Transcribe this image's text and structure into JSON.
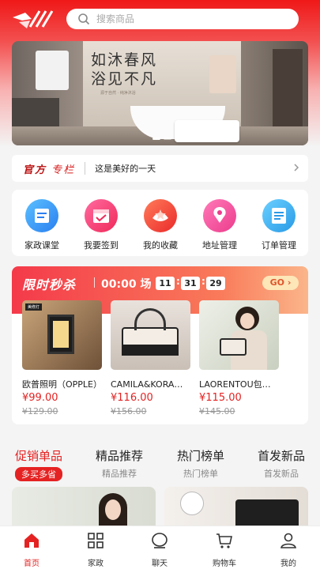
{
  "search": {
    "placeholder": "搜索商品"
  },
  "banner": {
    "slogan_line1": "如沐春风",
    "slogan_line2": "浴见不凡",
    "sub": "源于自然 · 纯净沐浴"
  },
  "official": {
    "tag_a": "官方",
    "tag_b": "专栏",
    "text": "这是美好的一天"
  },
  "grid": [
    {
      "label": "家政课堂",
      "icon": "classroom-icon",
      "color": "#3a9af0"
    },
    {
      "label": "我要签到",
      "icon": "checkin-calendar-icon",
      "color": "#f0356b"
    },
    {
      "label": "我的收藏",
      "icon": "favorites-icon",
      "color": "#f24a38"
    },
    {
      "label": "地址管理",
      "icon": "location-icon",
      "color": "#f04a8a"
    },
    {
      "label": "订单管理",
      "icon": "order-list-icon",
      "color": "#3ab0f0"
    }
  ],
  "flash": {
    "title": "限时秒杀",
    "session": "00:00 场",
    "hours": "11",
    "minutes": "31",
    "seconds": "29",
    "go": "GO",
    "products": [
      {
        "name": "欧普照明（OPPLE）",
        "price": "¥99.00",
        "old": "¥129.00",
        "badge": "美修灯"
      },
      {
        "name": "CAMILA&KORA包包",
        "price": "¥116.00",
        "old": "¥156.00"
      },
      {
        "name": "LAORENTOU包包女",
        "price": "¥115.00",
        "old": "¥145.00"
      }
    ]
  },
  "tabs": [
    {
      "main": "促销单品",
      "sub": "多买多省"
    },
    {
      "main": "精品推荐",
      "sub": "精品推荐"
    },
    {
      "main": "热门榜单",
      "sub": "热门榜单"
    },
    {
      "main": "首发新品",
      "sub": "首发新品"
    }
  ],
  "tabbar": [
    {
      "label": "首页",
      "icon": "home-icon"
    },
    {
      "label": "家政",
      "icon": "grid-icon"
    },
    {
      "label": "聊天",
      "icon": "chat-icon"
    },
    {
      "label": "购物车",
      "icon": "cart-icon"
    },
    {
      "label": "我的",
      "icon": "user-icon"
    }
  ],
  "colors": {
    "brand": "#e52222",
    "header": "#f01818"
  }
}
